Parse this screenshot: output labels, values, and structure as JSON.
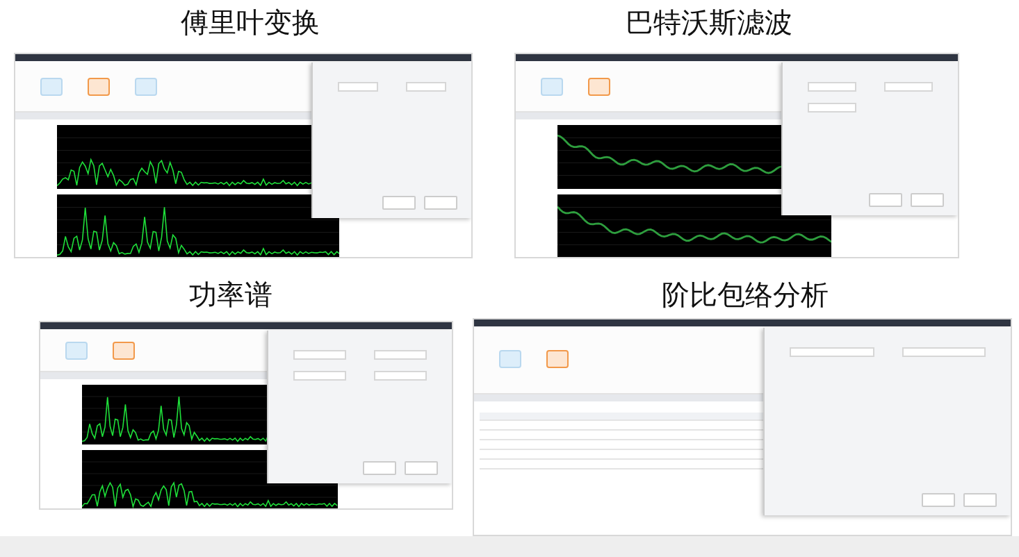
{
  "panels": [
    {
      "title": "傅里叶变换",
      "kind": "spectrum"
    },
    {
      "title": "巴特沃斯滤波",
      "kind": "filter"
    },
    {
      "title": "功率谱",
      "kind": "spectrum"
    },
    {
      "title": "阶比包络分析",
      "kind": "table"
    }
  ]
}
